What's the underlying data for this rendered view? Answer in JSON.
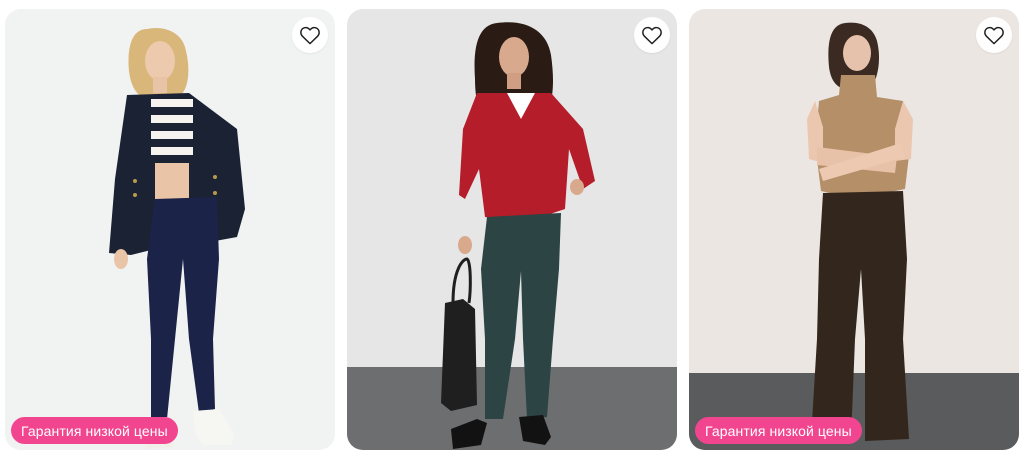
{
  "colors": {
    "badge": "#f2458f",
    "heart_stroke": "#1f1f1f",
    "card1_bg": "#f1f2f2",
    "card2_bg": "#e6e6e6",
    "card2_floor": "#6d6e70",
    "card3_bg": "#ebe6e2",
    "card3_floor": "#5a5b5c"
  },
  "cards": [
    {
      "favorite_icon": "heart-icon",
      "badge_label": "Гарантия низкой цены"
    },
    {
      "favorite_icon": "heart-icon"
    },
    {
      "favorite_icon": "heart-icon",
      "badge_label": "Гарантия низкой цены"
    }
  ]
}
